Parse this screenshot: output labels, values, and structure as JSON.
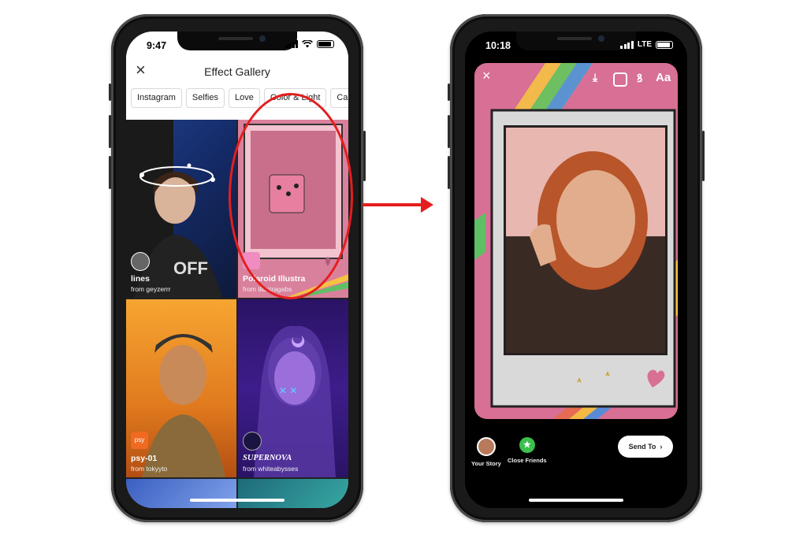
{
  "left_phone": {
    "status": {
      "time": "9:47"
    },
    "header": {
      "close_icon": "close-x",
      "title": "Effect Gallery"
    },
    "categories": [
      "Instagram",
      "Selfies",
      "Love",
      "Color & Light",
      "Camer"
    ],
    "effects": [
      {
        "name": "lines",
        "creator": "from geyzerrr"
      },
      {
        "name": "Polaroid Illustra",
        "creator": "from illustragabs"
      },
      {
        "name": "psy-01",
        "creator": "from tokyyto",
        "badge": "psy"
      },
      {
        "name": "SUPERNOVA",
        "creator": "from whiteabysses"
      }
    ]
  },
  "right_phone": {
    "status": {
      "time": "10:18",
      "network": "LTE"
    },
    "toolbar": {
      "close_icon": "close-x",
      "download_icon": "download",
      "sticker_icon": "sticker",
      "draw_icon": "draw",
      "text_tool": "Aa"
    },
    "share": {
      "your_story": "Your Story",
      "close_friends": "Close Friends",
      "send_to": "Send To"
    }
  },
  "colors": {
    "highlight": "#e41e1e",
    "story_bg": "#d86f95",
    "close_friends": "#3bbf4e"
  }
}
